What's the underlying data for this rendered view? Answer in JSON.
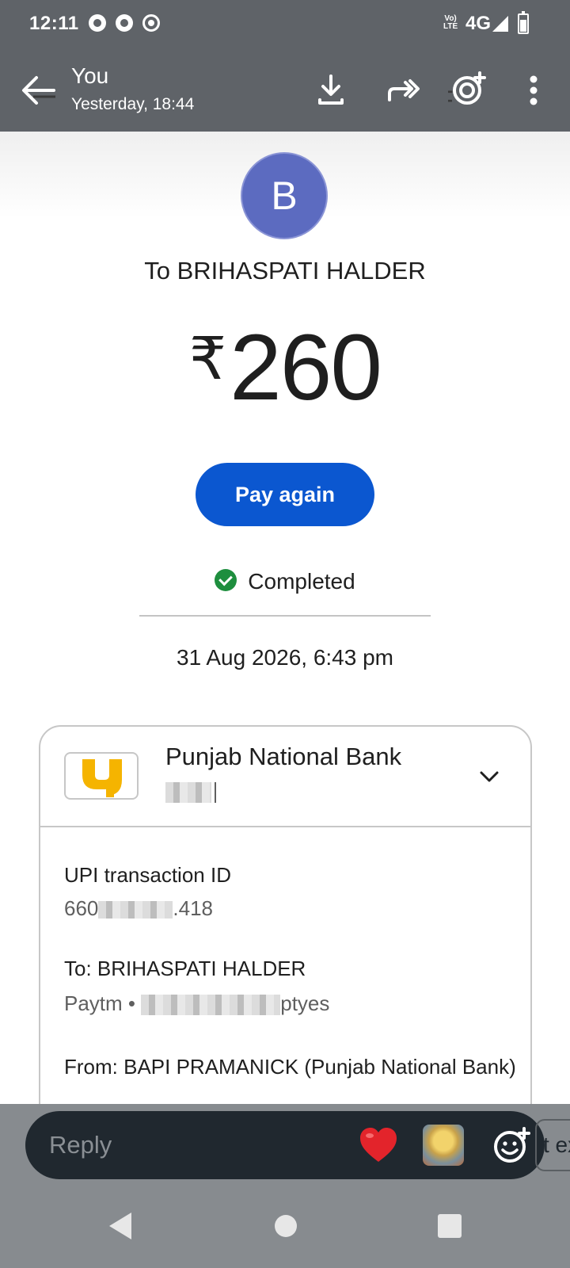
{
  "status_bar": {
    "time": "12:11",
    "network_label": "4G",
    "volte_label": "Vo) LTE"
  },
  "app_bar": {
    "sender": "You",
    "timestamp": "Yesterday, 18:44"
  },
  "payment": {
    "avatar_initial": "B",
    "recipient_line": "To BRIHASPATI HALDER",
    "currency_symbol": "₹",
    "amount": "260",
    "pay_again_label": "Pay again",
    "status": "Completed",
    "status_color": "#1e8e3e",
    "date_time": "31 Aug 2026, 6:43 pm"
  },
  "details": {
    "bank_name": "Punjab National Bank",
    "upi_label": "UPI transaction ID",
    "upi_prefix": "660",
    "upi_suffix": ".418",
    "to_label": "To: BRIHASPATI HALDER",
    "to_provider": "Paytm •",
    "to_handle_suffix": "ptyes",
    "from_label": "From: BAPI PRAMANICK (Punjab National Bank)"
  },
  "reply": {
    "placeholder": "Reply",
    "chip_text": "t ex"
  },
  "colors": {
    "accent": "#0b57d0",
    "avatar": "#5c6bc0",
    "app_bar": "#5f6368"
  }
}
